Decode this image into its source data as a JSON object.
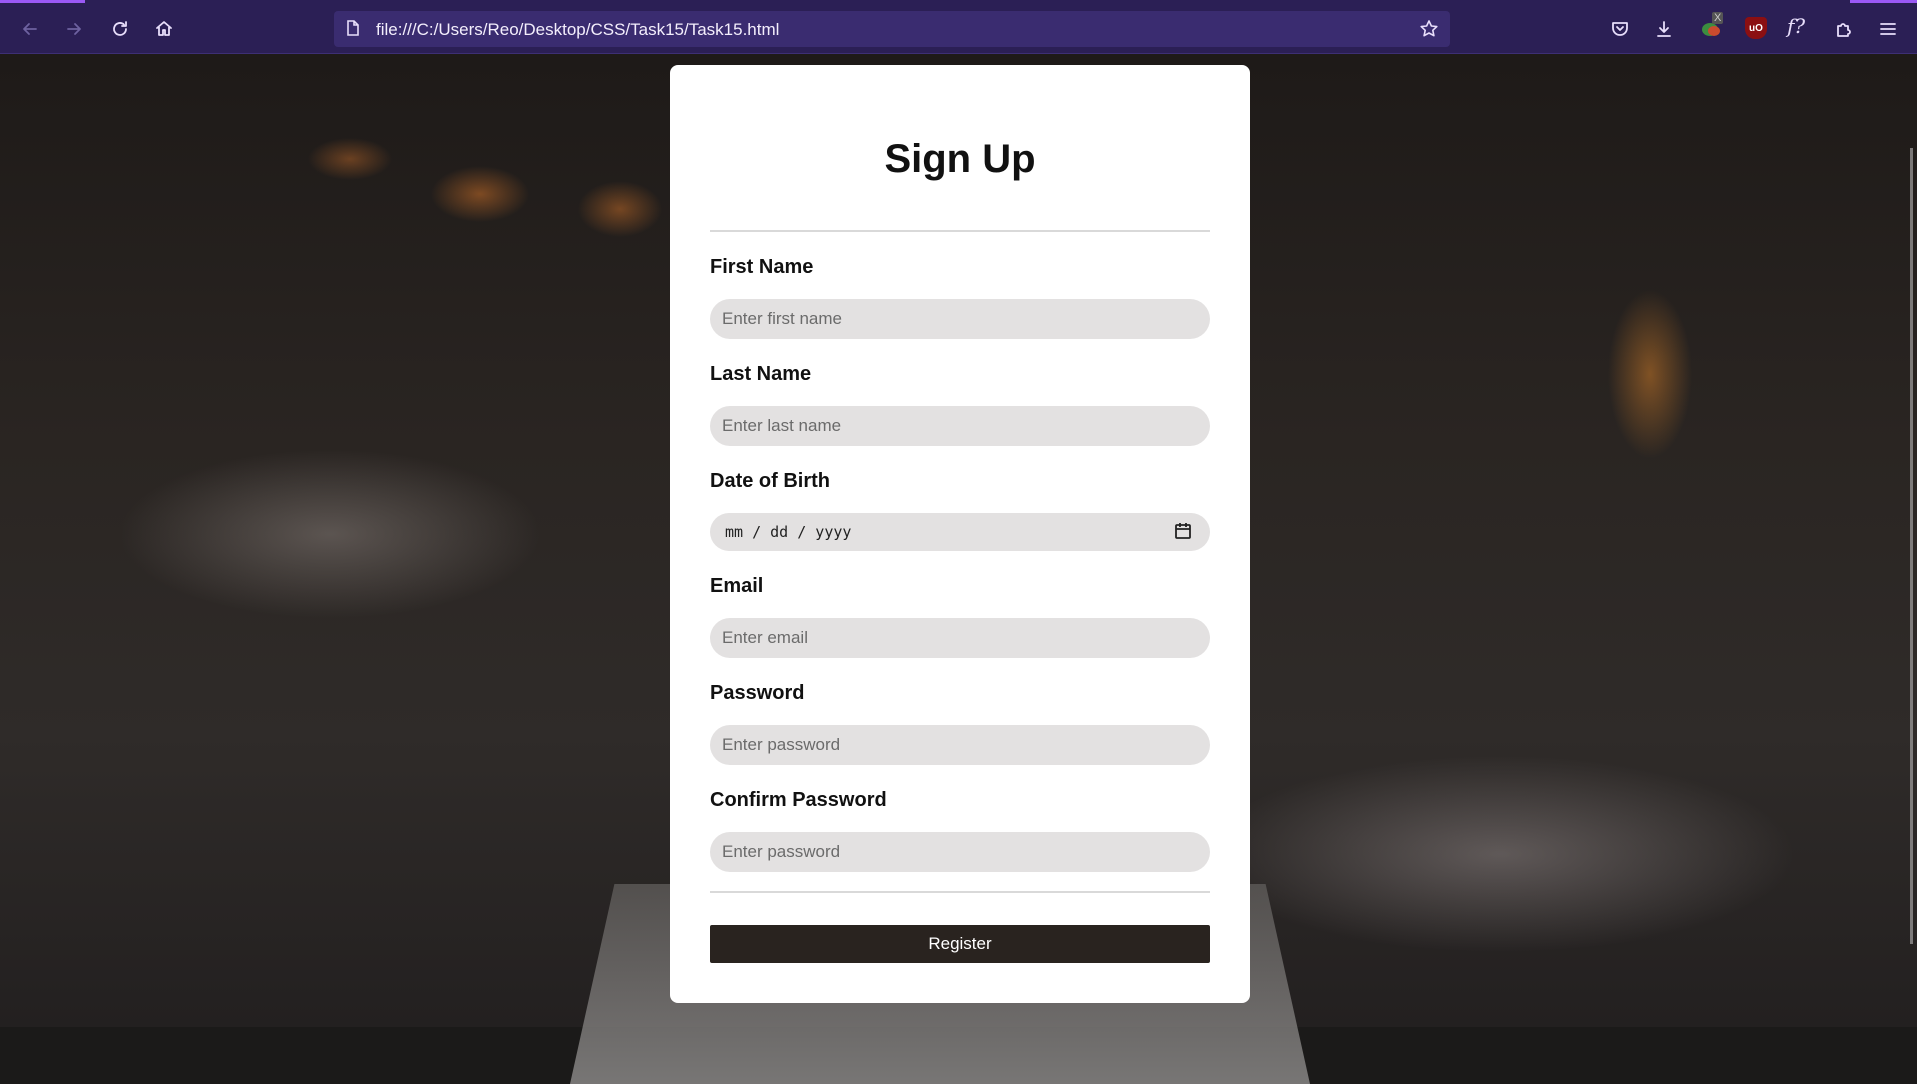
{
  "browser": {
    "url": "file:///C:/Users/Reo/Desktop/CSS/Task15/Task15.html",
    "extension_badge": "X",
    "ublock_label": "uO",
    "fx_label": "f?",
    "icons": [
      "back-arrow-icon",
      "forward-arrow-icon",
      "reload-icon",
      "home-icon",
      "page-icon",
      "bookmark-star-icon",
      "pocket-icon",
      "download-icon",
      "multi-account-extension-icon",
      "ublock-icon",
      "font-finder-icon",
      "extensions-puzzle-icon",
      "menu-hamburger-icon"
    ]
  },
  "form": {
    "title": "Sign Up",
    "fields": [
      {
        "label": "First Name",
        "placeholder": "Enter first name"
      },
      {
        "label": "Last Name",
        "placeholder": "Enter last name"
      },
      {
        "label": "Date of Birth",
        "placeholder": "mm / dd / yyyy"
      },
      {
        "label": "Email",
        "placeholder": "Enter email"
      },
      {
        "label": "Password",
        "placeholder": "Enter password"
      },
      {
        "label": "Confirm Password",
        "placeholder": "Enter password"
      }
    ],
    "submit_label": "Register"
  },
  "colors": {
    "toolbar": "#2b1f55",
    "urlbar": "#3a2c70",
    "card": "#ffffff",
    "input_bg": "#e3e1e1",
    "button_bg": "#29231f"
  }
}
